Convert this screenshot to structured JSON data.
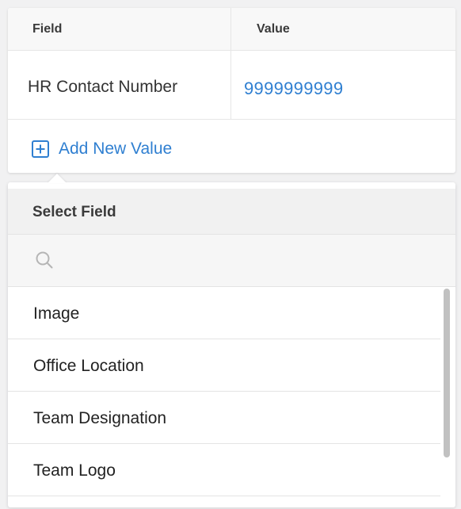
{
  "table": {
    "headers": {
      "field": "Field",
      "value": "Value"
    },
    "rows": [
      {
        "field": "HR Contact Number",
        "value": "9999999999"
      }
    ],
    "add_button_label": "Add New Value",
    "add_icon": "plus-square-icon"
  },
  "dropdown": {
    "title": "Select Field",
    "search": {
      "placeholder": "",
      "value": "",
      "icon": "search-icon"
    },
    "items": [
      {
        "label": "Image"
      },
      {
        "label": "Office Location"
      },
      {
        "label": "Team Designation"
      },
      {
        "label": "Team Logo"
      }
    ],
    "scroll_position": 0
  },
  "colors": {
    "accent": "#2f7fd1",
    "background": "#f1f1f2",
    "header_bg": "#f1f1f1",
    "text": "#333333",
    "scrollbar": "#c1c1c1"
  }
}
